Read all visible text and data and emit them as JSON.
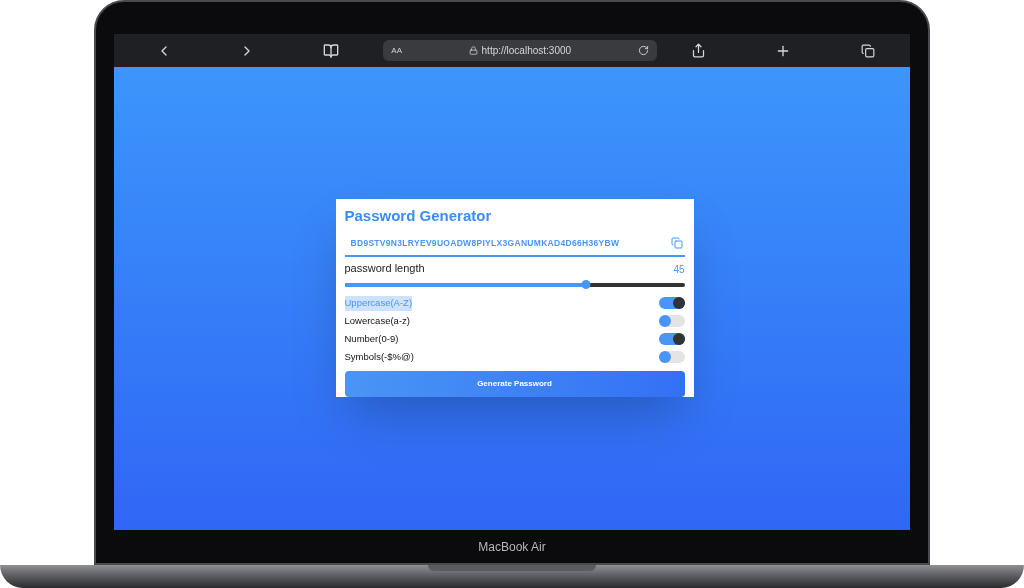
{
  "browser": {
    "text_size_button": "AA",
    "url": "http://localhost:3000"
  },
  "card": {
    "title": "Password Generator",
    "password": "BD9STV9N3LRYEV9UOADW8PIYLX3GANUMKAD4D66H36YBW",
    "length_label": "password length",
    "length_value": "45",
    "length_slider": {
      "level": 0.71
    },
    "options": [
      {
        "label": "Uppercase(A-Z)",
        "on": true,
        "highlighted": true
      },
      {
        "label": "Lowercase(a-z)",
        "on": false,
        "highlighted": false
      },
      {
        "label": "Number(0-9)",
        "on": true,
        "highlighted": false
      },
      {
        "label": "Symbols(-$%@)",
        "on": false,
        "highlighted": false
      }
    ],
    "generate_button": "Generate Password"
  },
  "device_label": "MacBook Air"
}
